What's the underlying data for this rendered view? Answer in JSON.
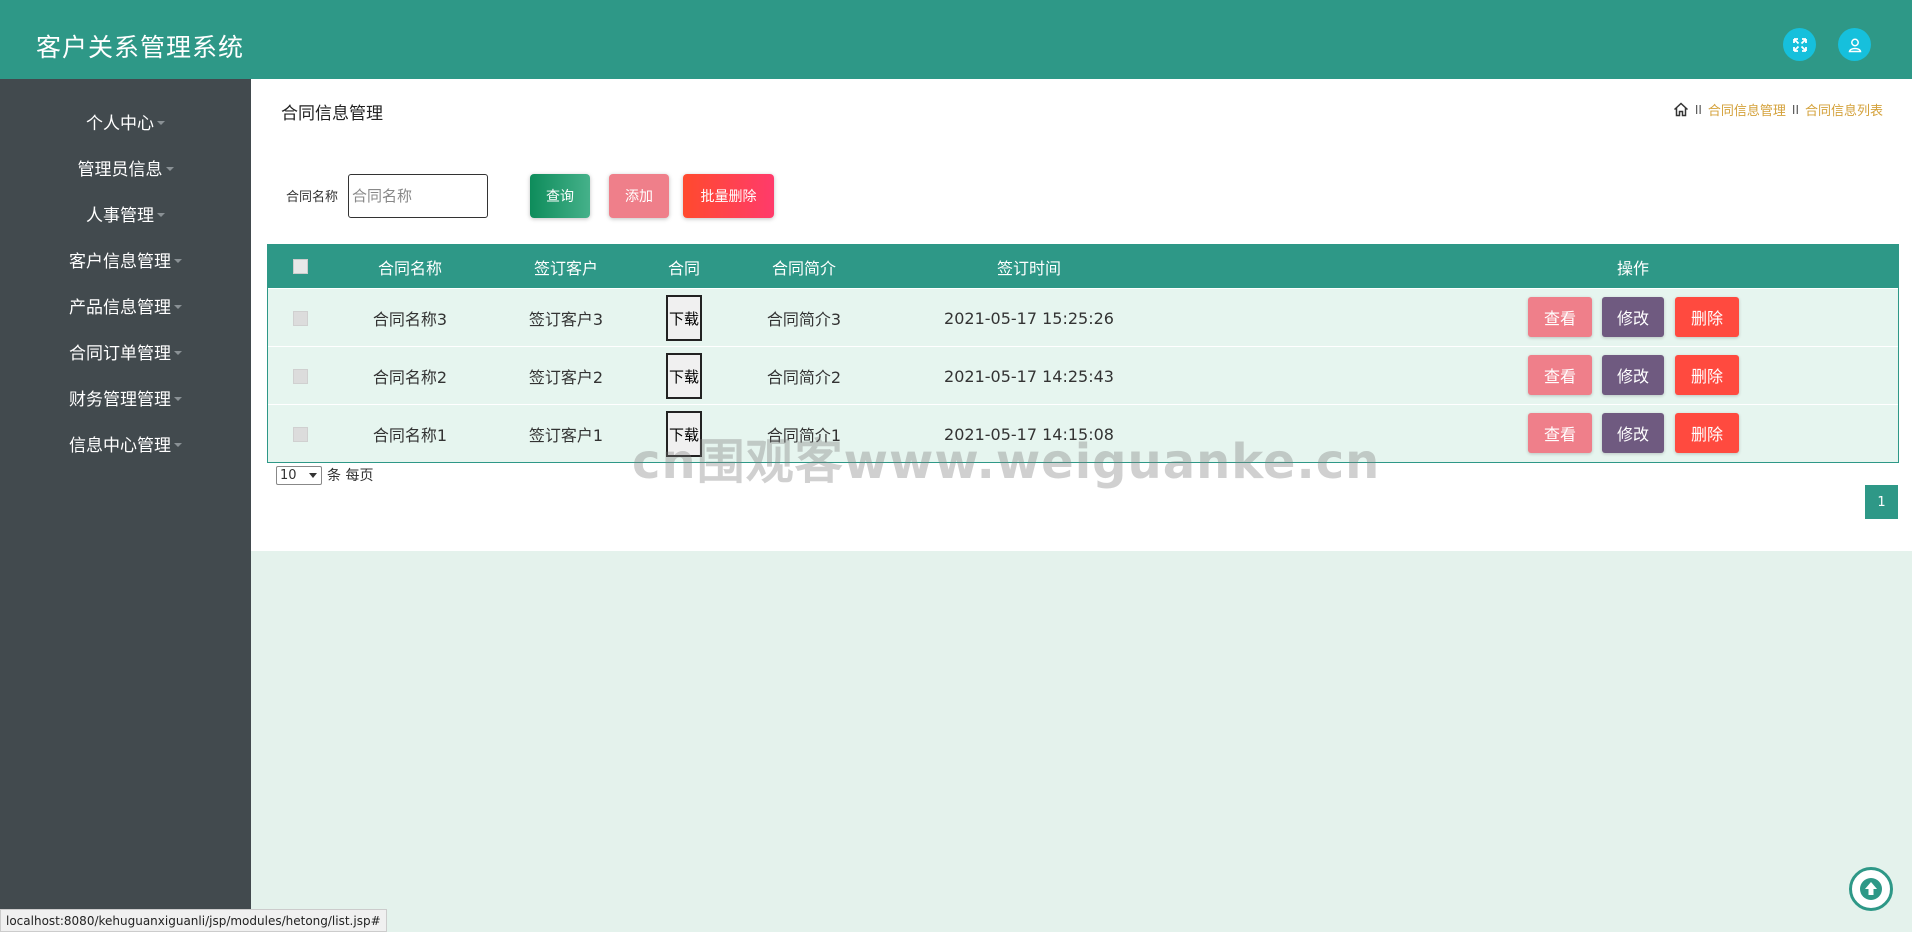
{
  "header": {
    "title": "客户关系管理系统",
    "fullscreen_icon": "expand-icon",
    "user_icon": "user-icon"
  },
  "sidebar": {
    "items": [
      {
        "label": "个人中心"
      },
      {
        "label": "管理员信息"
      },
      {
        "label": "人事管理"
      },
      {
        "label": "客户信息管理"
      },
      {
        "label": "产品信息管理"
      },
      {
        "label": "合同订单管理"
      },
      {
        "label": "财务管理管理"
      },
      {
        "label": "信息中心管理"
      }
    ]
  },
  "main": {
    "page_title": "合同信息管理",
    "breadcrumb": {
      "home_icon": "home-icon",
      "separator": "II",
      "items": [
        "合同信息管理",
        "合同信息列表"
      ]
    },
    "search": {
      "label": "合同名称",
      "placeholder": "合同名称",
      "value": "",
      "query_label": "查询",
      "add_label": "添加",
      "batch_delete_label": "批量删除"
    },
    "table": {
      "headers": [
        "合同名称",
        "签订客户",
        "合同",
        "合同简介",
        "签订时间",
        "操作"
      ],
      "rows": [
        {
          "name": "合同名称3",
          "customer": "签订客户3",
          "download": "下载",
          "intro": "合同简介3",
          "time": "2021-05-17 15:25:26"
        },
        {
          "name": "合同名称2",
          "customer": "签订客户2",
          "download": "下载",
          "intro": "合同简介2",
          "time": "2021-05-17 14:25:43"
        },
        {
          "name": "合同名称1",
          "customer": "签订客户1",
          "download": "下载",
          "intro": "合同简介1",
          "time": "2021-05-17 14:15:08"
        }
      ],
      "actions": {
        "view": "查看",
        "edit": "修改",
        "delete": "删除"
      }
    },
    "pagination": {
      "page_size": "10",
      "page_size_suffix": "条 每页",
      "current_page": "1"
    }
  },
  "watermark": "cn围观客www.weiguanke.cn",
  "statusbar": {
    "url": "localhost:8080/kehuguanxiguanli/jsp/modules/hetong/list.jsp#"
  },
  "colors": {
    "primary": "#2e9887",
    "sidebar": "#424a4e",
    "accent_cyan": "#16c0dc",
    "view": "#ef7f8a",
    "edit": "#6f5a80",
    "delete": "#ff4a3f",
    "breadcrumb_link": "#d4a13a"
  }
}
